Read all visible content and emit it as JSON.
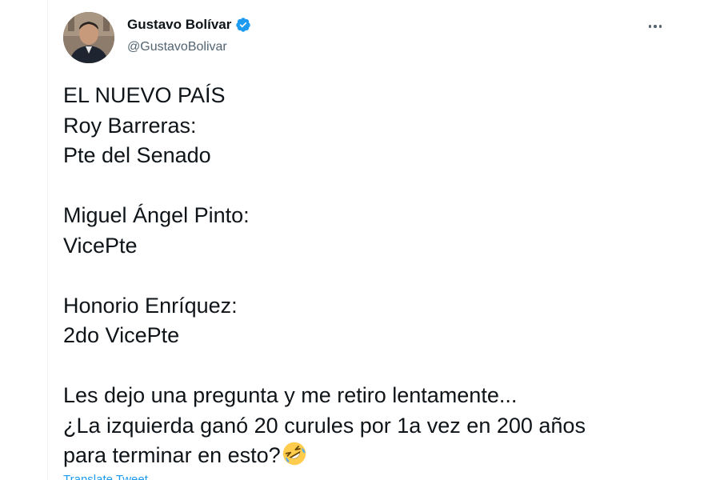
{
  "author": {
    "display_name": "Gustavo Bolívar",
    "handle": "@GustavoBolivar",
    "verified": true,
    "verified_color": "#1d9bf0"
  },
  "tweet": {
    "lines": [
      "EL NUEVO PAÍS",
      "Roy Barreras:",
      "Pte del Senado",
      "",
      "Miguel Ángel Pinto:",
      "VicePte",
      "",
      "Honorio Enríquez:",
      "2do VicePte",
      "",
      "Les dejo una pregunta y me retiro lentamente...",
      "¿La izquierda ganó 20 curules por 1a vez en 200 años",
      "para terminar en esto?"
    ],
    "emoji": "rolling-on-the-floor-laughing",
    "translate_label": "Translate Tweet"
  },
  "icons": {
    "verified": "verified-badge-icon",
    "more": "more-options-icon"
  }
}
